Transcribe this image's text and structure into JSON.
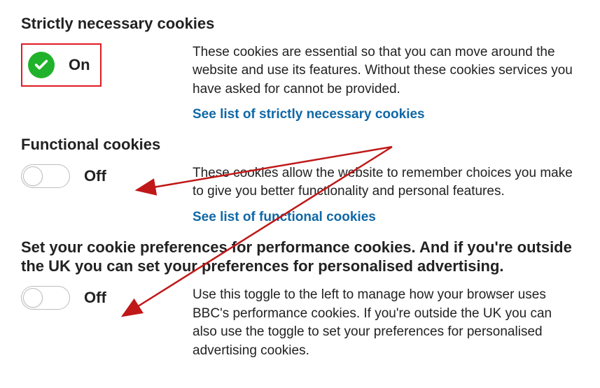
{
  "sections": {
    "strict": {
      "title": "Strictly necessary cookies",
      "state": "On",
      "desc": "These cookies are essential so that you can move around the website and use its features. Without these cookies services you have asked for cannot be provided.",
      "link": "See list of strictly necessary cookies"
    },
    "functional": {
      "title": "Functional cookies",
      "state": "Off",
      "desc": "These cookies allow the website to remember choices you make to give you better functionality and personal features.",
      "link": "See list of functional cookies"
    },
    "performance": {
      "title": "Set your cookie preferences for performance cookies. And if you're outside the UK you can set your preferences for personalised advertising.",
      "state": "Off",
      "desc": "Use this toggle to the left to manage how your browser uses BBC's performance cookies. If you're outside the UK you can also use the toggle to set your preferences for personalised advertising cookies."
    }
  }
}
